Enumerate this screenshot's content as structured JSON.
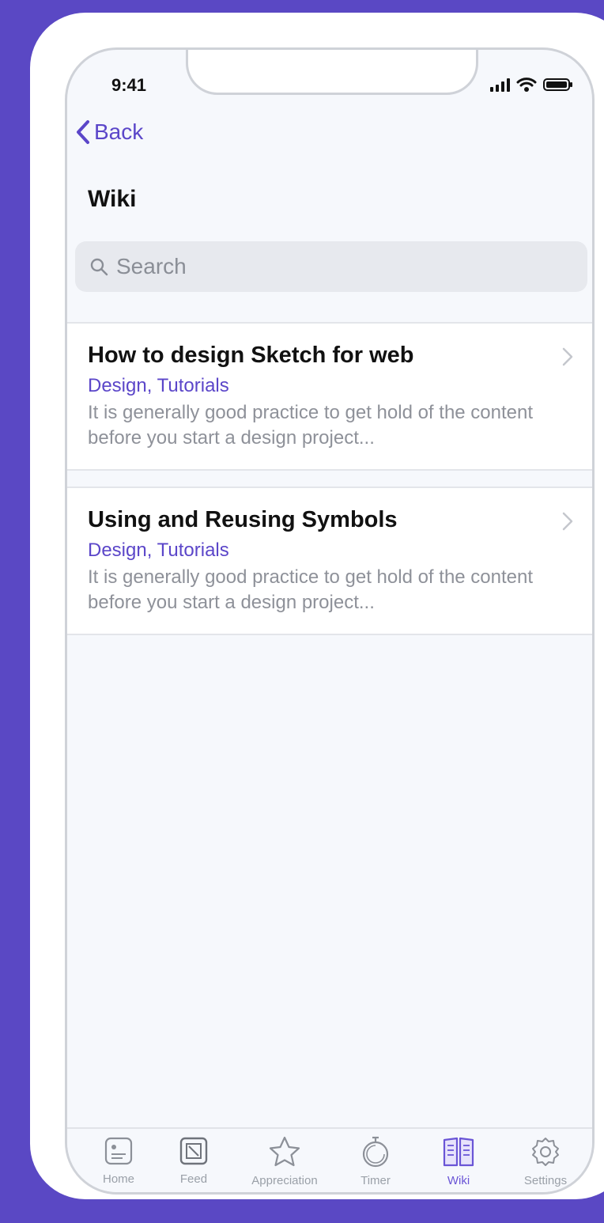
{
  "status": {
    "time": "9:41"
  },
  "nav": {
    "back_label": "Back",
    "title": "Wiki"
  },
  "search": {
    "placeholder": "Search"
  },
  "articles": [
    {
      "title": "How to design Sketch for web",
      "categories": "Design, Tutorials",
      "excerpt": "It is generally good practice to get hold of the content before you start a design project..."
    },
    {
      "title": "Using and Reusing Symbols",
      "categories": "Design, Tutorials",
      "excerpt": "It is generally good practice to get hold of the content before you start a design project..."
    }
  ],
  "tabs": [
    {
      "label": "Home",
      "icon": "home-icon"
    },
    {
      "label": "Feed",
      "icon": "feed-icon"
    },
    {
      "label": "Appreciation",
      "icon": "star-icon"
    },
    {
      "label": "Timer",
      "icon": "stopwatch-icon"
    },
    {
      "label": "Wiki",
      "icon": "book-icon",
      "active": true
    },
    {
      "label": "Settings",
      "icon": "gear-icon"
    }
  ],
  "colors": {
    "background": "#5a48c4",
    "accent": "#5b46c9",
    "screen": "#f6f8fc"
  }
}
